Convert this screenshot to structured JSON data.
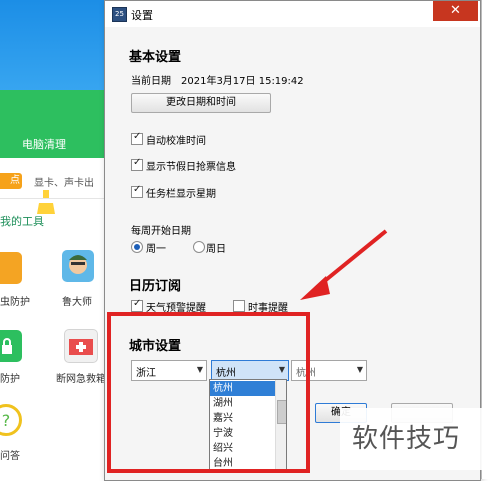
{
  "background_app": {
    "clean_label": "电脑清理",
    "pill_label": "点",
    "drivers_text": "显卡、声卡出",
    "tools_title": "我的工具",
    "tools": [
      {
        "label": "虫防护"
      },
      {
        "label": "鲁大师"
      },
      {
        "label": "防护"
      },
      {
        "label": "断网急救箱"
      },
      {
        "label": "问答"
      }
    ]
  },
  "dialog": {
    "title": "设置",
    "close_symbol": "✕",
    "basic": {
      "title": "基本设置",
      "current_date_label": "当前日期",
      "current_date_value": "2021年3月17日 15:19:42",
      "change_button": "更改日期和时间",
      "options": [
        {
          "label": "自动校准时间",
          "checked": true
        },
        {
          "label": "显示节假日抢票信息",
          "checked": true
        },
        {
          "label": "任务栏显示星期",
          "checked": true
        }
      ],
      "week_start_label": "每周开始日期",
      "week_start_options": [
        {
          "label": "周一",
          "selected": true
        },
        {
          "label": "周日",
          "selected": false
        }
      ]
    },
    "subscription": {
      "title": "日历订阅",
      "weather": {
        "label": "天气预警提醒",
        "checked": true
      },
      "news": {
        "label": "时事提醒",
        "checked": false
      }
    },
    "city": {
      "title": "城市设置",
      "province": "浙江",
      "city": "杭州",
      "district": "杭州",
      "options": [
        "杭州",
        "湖州",
        "嘉兴",
        "宁波",
        "绍兴",
        "台州"
      ],
      "ok_button": "确定"
    }
  },
  "watermark": "软件技巧"
}
